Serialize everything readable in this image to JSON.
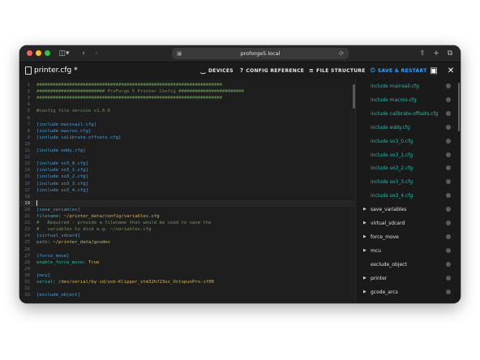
{
  "browser": {
    "url": "proforge5.local"
  },
  "toolbar": {
    "file_title": "printer.cfg *",
    "devices_label": "DEVICES",
    "config_reference_label": "CONFIG REFERENCE",
    "file_structure_label": "FILE STRUCTURE",
    "save_restart_label": "SAVE & RESTART"
  },
  "editor": {
    "current_line": 19,
    "lines": [
      {
        "n": "1",
        "t": [
          {
            "c": "com",
            "s": "####################################################################"
          }
        ]
      },
      {
        "n": "2",
        "t": [
          {
            "c": "com",
            "s": "######################### ProForge 5 Printer Config ########################"
          }
        ]
      },
      {
        "n": "3",
        "t": [
          {
            "c": "com",
            "s": "####################################################################"
          }
        ]
      },
      {
        "n": "4",
        "t": []
      },
      {
        "n": "5",
        "t": [
          {
            "c": "com",
            "s": "#config file version v1.0.0"
          }
        ]
      },
      {
        "n": "6",
        "t": []
      },
      {
        "n": "7",
        "t": [
          {
            "c": "sec",
            "s": "[include mainsail.cfg]"
          }
        ]
      },
      {
        "n": "8",
        "t": [
          {
            "c": "sec",
            "s": "[include macros.cfg]"
          }
        ]
      },
      {
        "n": "9",
        "t": [
          {
            "c": "sec",
            "s": "[include calibrate-offsets.cfg]"
          }
        ]
      },
      {
        "n": "10",
        "t": []
      },
      {
        "n": "11",
        "t": [
          {
            "c": "sec",
            "s": "[include eddy.cfg]"
          }
        ]
      },
      {
        "n": "12",
        "t": []
      },
      {
        "n": "13",
        "t": [
          {
            "c": "sec",
            "s": "[include so3_0.cfg]"
          }
        ]
      },
      {
        "n": "14",
        "t": [
          {
            "c": "sec",
            "s": "[include so3_1.cfg]"
          }
        ]
      },
      {
        "n": "15",
        "t": [
          {
            "c": "sec",
            "s": "[include so3_2.cfg]"
          }
        ]
      },
      {
        "n": "16",
        "t": [
          {
            "c": "sec",
            "s": "[include so3_3.cfg]"
          }
        ]
      },
      {
        "n": "17",
        "t": [
          {
            "c": "sec",
            "s": "[include so3_4.cfg]"
          }
        ]
      },
      {
        "n": "18",
        "t": []
      },
      {
        "n": "19",
        "t": []
      },
      {
        "n": "20",
        "t": [
          {
            "c": "sec",
            "s": "[save_variables]"
          }
        ]
      },
      {
        "n": "21",
        "t": [
          {
            "c": "key",
            "s": "filename"
          },
          {
            "c": "plain",
            "s": ": "
          },
          {
            "c": "val",
            "s": "~/printer_data/config/variables.cfg"
          }
        ]
      },
      {
        "n": "22",
        "t": [
          {
            "c": "com",
            "s": "#   Required - provide a filename that would be used to save the"
          }
        ]
      },
      {
        "n": "23",
        "t": [
          {
            "c": "com",
            "s": "#   variables to disk e.g. ~/variables.cfg"
          }
        ]
      },
      {
        "n": "24",
        "t": [
          {
            "c": "sec",
            "s": "[virtual_sdcard]"
          }
        ]
      },
      {
        "n": "25",
        "t": [
          {
            "c": "key",
            "s": "path"
          },
          {
            "c": "plain",
            "s": ": "
          },
          {
            "c": "val",
            "s": "~/printer_data/gcodes"
          }
        ]
      },
      {
        "n": "26",
        "t": []
      },
      {
        "n": "27",
        "t": [
          {
            "c": "sec",
            "s": "[force_move]"
          }
        ]
      },
      {
        "n": "28",
        "t": [
          {
            "c": "key",
            "s": "enable_force_move"
          },
          {
            "c": "plain",
            "s": ": "
          },
          {
            "c": "val",
            "s": "True"
          }
        ]
      },
      {
        "n": "29",
        "t": []
      },
      {
        "n": "30",
        "t": [
          {
            "c": "sec",
            "s": "[mcu]"
          }
        ]
      },
      {
        "n": "31",
        "t": [
          {
            "c": "key",
            "s": "serial"
          },
          {
            "c": "plain",
            "s": ": "
          },
          {
            "c": "val",
            "s": "/dev/serial/by-id/usb-Klipper_stm32h723xx_OctopusPro-if00"
          }
        ]
      },
      {
        "n": "32",
        "t": []
      },
      {
        "n": "33",
        "t": [
          {
            "c": "sec",
            "s": "[exclude_object]"
          }
        ]
      }
    ]
  },
  "sidebar": {
    "items": [
      {
        "label": "include mainsail.cfg",
        "kind": "inc",
        "expandable": false
      },
      {
        "label": "include macros.cfg",
        "kind": "inc",
        "expandable": false
      },
      {
        "label": "include calibrate-offsets.cfg",
        "kind": "inc",
        "expandable": false
      },
      {
        "label": "include eddy.cfg",
        "kind": "inc",
        "expandable": false
      },
      {
        "label": "include so3_0.cfg",
        "kind": "inc",
        "expandable": false
      },
      {
        "label": "include so3_1.cfg",
        "kind": "inc",
        "expandable": false
      },
      {
        "label": "include so3_2.cfg",
        "kind": "inc",
        "expandable": false
      },
      {
        "label": "include so3_3.cfg",
        "kind": "inc",
        "expandable": false
      },
      {
        "label": "include so3_4.cfg",
        "kind": "inc",
        "expandable": false
      },
      {
        "label": "save_variables",
        "kind": "sec",
        "expandable": true
      },
      {
        "label": "virtual_sdcard",
        "kind": "sec",
        "expandable": true
      },
      {
        "label": "force_move",
        "kind": "sec",
        "expandable": true
      },
      {
        "label": "mcu",
        "kind": "sec",
        "expandable": true
      },
      {
        "label": "exclude_object",
        "kind": "sec",
        "expandable": false
      },
      {
        "label": "printer",
        "kind": "sec",
        "expandable": true
      },
      {
        "label": "gcode_arcs",
        "kind": "sec",
        "expandable": true
      }
    ]
  },
  "icons": {
    "close": "close-icon",
    "save": "floppy-disk-icon",
    "devices": "plug-icon",
    "config_reference": "question-icon",
    "file_structure": "list-icon",
    "save_restart": "power-icon"
  },
  "colors": {
    "accent": "#3aa0ff",
    "comment": "#6a9955",
    "section": "#4e9fd6",
    "key": "#2fb5a8",
    "value": "#d7b45a"
  }
}
